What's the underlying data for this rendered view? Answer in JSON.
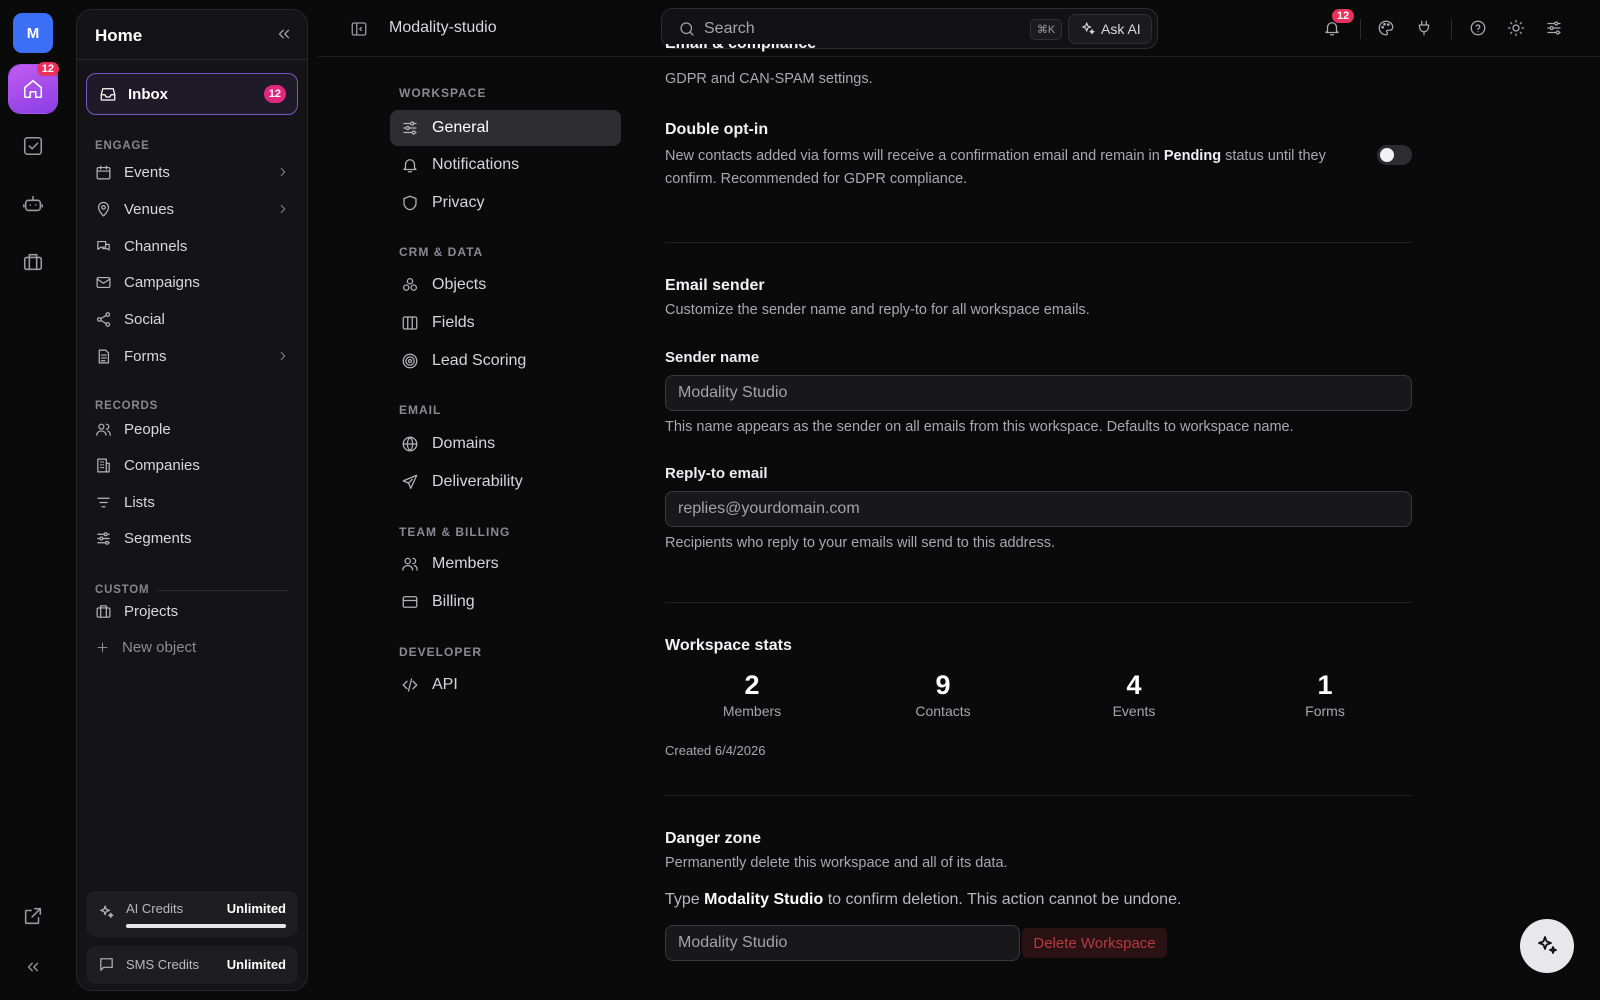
{
  "rail": {
    "avatar": "M",
    "home_badge": "12"
  },
  "sidebar": {
    "title": "Home",
    "inbox": {
      "label": "Inbox",
      "badge": "12"
    },
    "sections": {
      "engage": "ENGAGE",
      "records": "RECORDS",
      "custom": "CUSTOM"
    },
    "engage": [
      {
        "label": "Events",
        "icon": "calendar-icon",
        "chevron": true
      },
      {
        "label": "Venues",
        "icon": "map-pin-icon",
        "chevron": true
      },
      {
        "label": "Channels",
        "icon": "chat-icon",
        "chevron": false
      },
      {
        "label": "Campaigns",
        "icon": "mail-icon",
        "chevron": false
      },
      {
        "label": "Social",
        "icon": "share-icon",
        "chevron": false
      },
      {
        "label": "Forms",
        "icon": "document-icon",
        "chevron": true
      }
    ],
    "records": [
      {
        "label": "People",
        "icon": "users-icon"
      },
      {
        "label": "Companies",
        "icon": "building-icon"
      },
      {
        "label": "Lists",
        "icon": "list-icon"
      },
      {
        "label": "Segments",
        "icon": "sliders-icon"
      }
    ],
    "custom": [
      {
        "label": "Projects",
        "icon": "briefcase-icon"
      },
      {
        "label": "New object",
        "icon": "plus-icon"
      }
    ],
    "credits": {
      "ai_label": "AI Credits",
      "ai_value": "Unlimited",
      "ai_fill": 1.0,
      "sms_label": "SMS Credits",
      "sms_value": "Unlimited"
    }
  },
  "header": {
    "workspace": "Modality-studio",
    "search_placeholder": "Search",
    "shortcut": "⌘K",
    "ask_ai": "Ask AI",
    "notif_badge": "12"
  },
  "settings_nav": {
    "sections": [
      {
        "title": "WORKSPACE",
        "items": [
          {
            "label": "General",
            "icon": "sliders-icon",
            "active": true
          },
          {
            "label": "Notifications",
            "icon": "bell-icon"
          },
          {
            "label": "Privacy",
            "icon": "shield-icon"
          }
        ]
      },
      {
        "title": "CRM & DATA",
        "items": [
          {
            "label": "Objects",
            "icon": "cubes-icon"
          },
          {
            "label": "Fields",
            "icon": "columns-icon"
          },
          {
            "label": "Lead Scoring",
            "icon": "target-icon"
          }
        ]
      },
      {
        "title": "EMAIL",
        "items": [
          {
            "label": "Domains",
            "icon": "globe-icon"
          },
          {
            "label": "Deliverability",
            "icon": "send-icon"
          }
        ]
      },
      {
        "title": "TEAM & BILLING",
        "items": [
          {
            "label": "Members",
            "icon": "users-icon"
          },
          {
            "label": "Billing",
            "icon": "card-icon"
          }
        ]
      },
      {
        "title": "DEVELOPER",
        "items": [
          {
            "label": "API",
            "icon": "code-icon"
          }
        ]
      }
    ]
  },
  "main": {
    "compliance": {
      "title_partial": "Email & compliance",
      "desc": "GDPR and CAN-SPAM settings."
    },
    "double_optin": {
      "title": "Double opt-in",
      "desc_before": "New contacts added via forms will receive a confirmation email and remain in ",
      "desc_bold": "Pending",
      "desc_after": " status until they confirm. Recommended for GDPR compliance.",
      "enabled": false
    },
    "sender": {
      "title": "Email sender",
      "desc": "Customize the sender name and reply-to for all workspace emails.",
      "name_label": "Sender name",
      "name_placeholder": "Modality Studio",
      "name_help": "This name appears as the sender on all emails from this workspace. Defaults to workspace name.",
      "reply_label": "Reply-to email",
      "reply_placeholder": "replies@yourdomain.com",
      "reply_help": "Recipients who reply to your emails will send to this address."
    },
    "stats": {
      "title": "Workspace stats",
      "items": [
        {
          "value": "2",
          "label": "Members"
        },
        {
          "value": "9",
          "label": "Contacts"
        },
        {
          "value": "4",
          "label": "Events"
        },
        {
          "value": "1",
          "label": "Forms"
        }
      ],
      "created": "Created 6/4/2026"
    },
    "danger": {
      "title": "Danger zone",
      "desc": "Permanently delete this workspace and all of its data.",
      "confirm_before": "Type ",
      "confirm_bold": "Modality Studio",
      "confirm_after": " to confirm deletion. This action cannot be undone.",
      "input_placeholder": "Modality Studio",
      "button": "Delete Workspace"
    }
  },
  "colors": {
    "accent": "#8a3ee6",
    "badge": "#e9315a",
    "danger": "#b53a3f"
  }
}
